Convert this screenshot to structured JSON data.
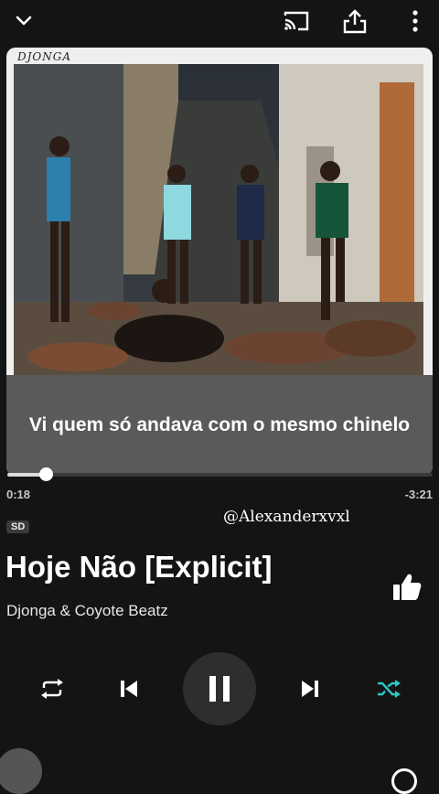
{
  "topbar": {
    "collapse_icon": "chevron-down-icon",
    "cast_icon": "cast-icon",
    "share_icon": "share-icon",
    "more_icon": "more-vert-icon"
  },
  "album": {
    "tag_text": "DJONGA"
  },
  "lyrics": {
    "current_line": "Vi quem só andava com o mesmo chinelo"
  },
  "playback": {
    "elapsed": "0:18",
    "remaining": "-3:21",
    "progress_fraction": 0.09
  },
  "track": {
    "quality_badge": "SD",
    "title": "Hoje Não [Explicit]",
    "artist": "Djonga & Coyote Beatz"
  },
  "overlay": {
    "watermark": "@Alexanderxvxl"
  },
  "controls": {
    "repeat_icon": "repeat-icon",
    "previous_icon": "skip-previous-icon",
    "pause_icon": "pause-icon",
    "next_icon": "skip-next-icon",
    "shuffle_icon": "shuffle-icon",
    "like_icon": "thumbs-up-icon",
    "shuffle_active_color": "#2ec5c5"
  }
}
